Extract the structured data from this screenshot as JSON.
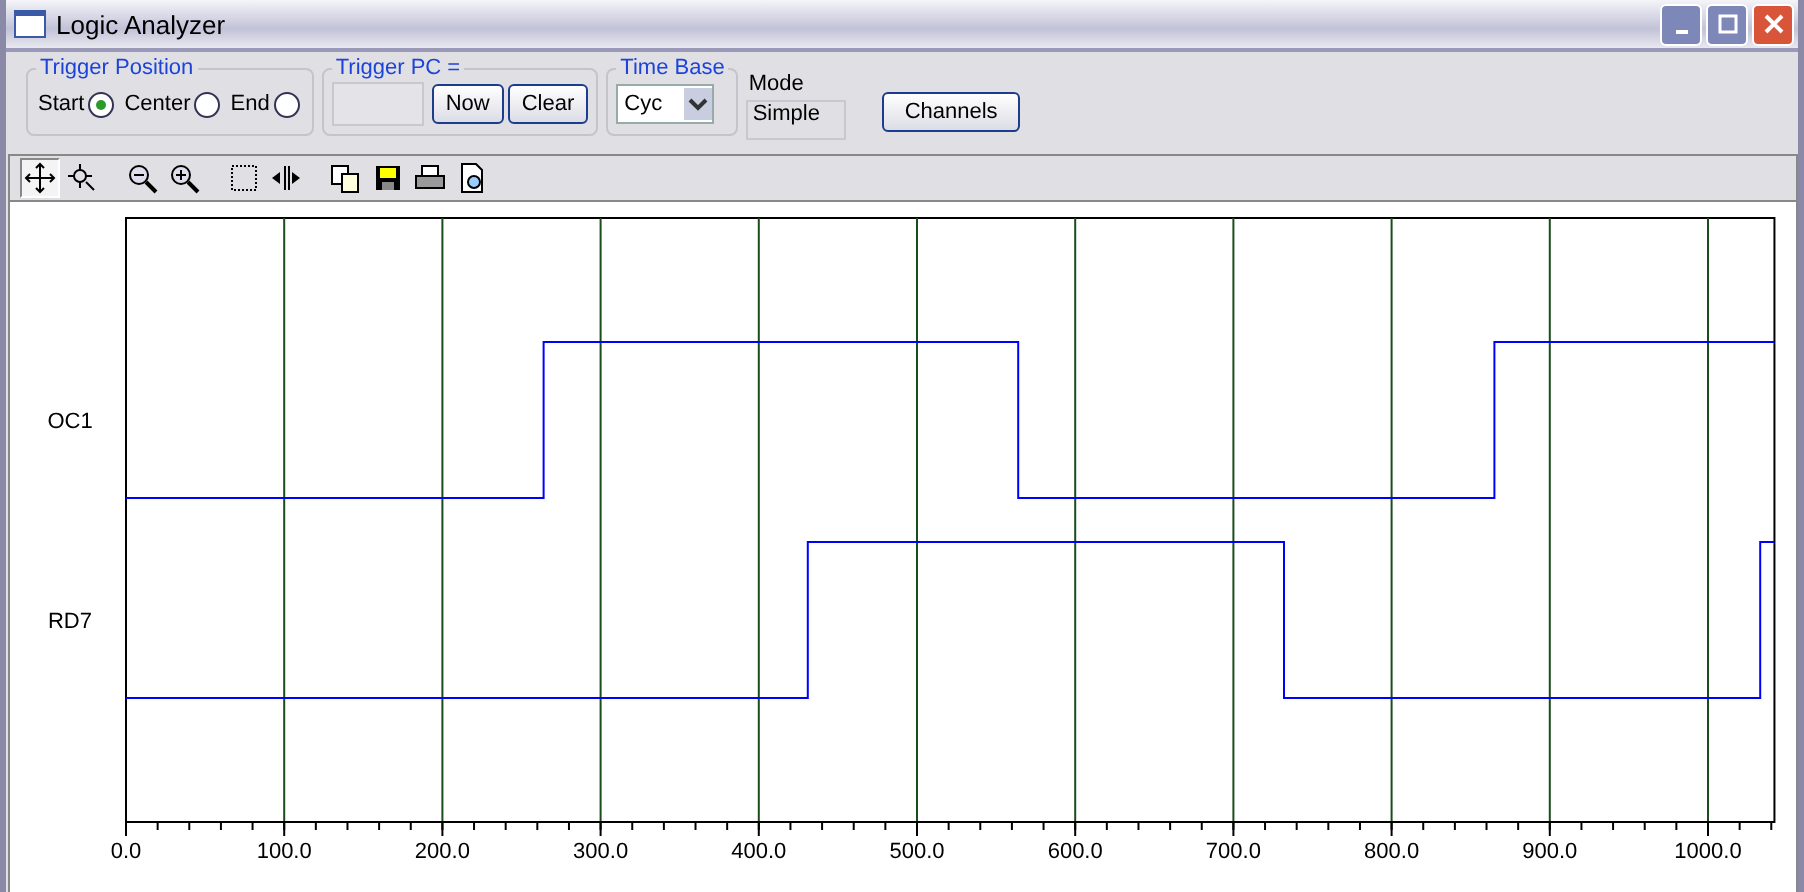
{
  "window": {
    "title": "Logic Analyzer"
  },
  "trigger_position": {
    "title": "Trigger Position",
    "options": [
      {
        "label": "Start",
        "selected": true
      },
      {
        "label": "Center",
        "selected": false
      },
      {
        "label": "End",
        "selected": false
      }
    ]
  },
  "trigger_pc": {
    "title": "Trigger PC =",
    "buttons": [
      "Now",
      "Clear"
    ]
  },
  "time_base": {
    "title": "Time Base",
    "value": "Cyc"
  },
  "mode": {
    "label": "Mode",
    "value": "Simple"
  },
  "channels_button": "Channels",
  "toolbar": [
    {
      "kind": "pan",
      "selected": true
    },
    {
      "kind": "zoomarea",
      "selected": false
    },
    {
      "kind": "zoomout",
      "selected": false
    },
    {
      "kind": "zoomin",
      "selected": false
    },
    {
      "kind": "select",
      "selected": false
    },
    {
      "kind": "cursors",
      "selected": false
    },
    {
      "kind": "copy",
      "selected": false
    },
    {
      "kind": "save",
      "selected": false
    },
    {
      "kind": "print",
      "selected": false
    },
    {
      "kind": "preview",
      "selected": false
    }
  ],
  "waveform": {
    "channels": [
      {
        "name": "OC1"
      },
      {
        "name": "RD7"
      }
    ],
    "axis_labels": [
      "0.0",
      "100.0",
      "200.0",
      "300.0",
      "400.0",
      "500.0",
      "600.0",
      "700.0",
      "800.0",
      "900.0",
      "1000.0"
    ]
  }
}
